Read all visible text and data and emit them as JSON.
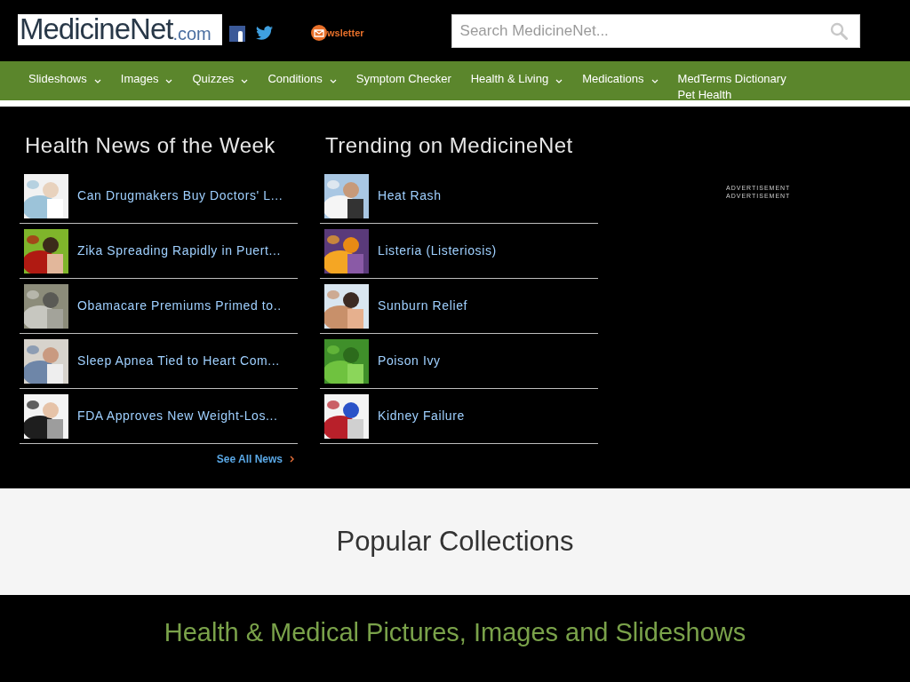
{
  "header": {
    "logo": {
      "main": "MedicineNet",
      "suffix": ".com"
    },
    "newsletter": "wsletter",
    "search": {
      "placeholder": "Search MedicineNet..."
    }
  },
  "nav": [
    {
      "label": "Slideshows",
      "dropdown": true
    },
    {
      "label": "Images",
      "dropdown": true
    },
    {
      "label": "Quizzes",
      "dropdown": true
    },
    {
      "label": "Conditions",
      "dropdown": true
    },
    {
      "label": "Symptom Checker",
      "dropdown": false
    },
    {
      "label": "Health & Living",
      "dropdown": true
    },
    {
      "label": "Medications",
      "dropdown": true
    },
    {
      "label": "MedTerms Dictionary",
      "dropdown": false
    },
    {
      "label": "Pet Health",
      "dropdown": false
    }
  ],
  "news": {
    "title": "Health News of the Week",
    "items": [
      {
        "title": "Can Drugmakers Buy Doctors' L..."
      },
      {
        "title": "Zika Spreading Rapidly in Puert..."
      },
      {
        "title": "Obamacare Premiums Primed to.."
      },
      {
        "title": "Sleep Apnea Tied to Heart Com..."
      },
      {
        "title": "FDA Approves New Weight-Los..."
      }
    ],
    "see_all": "See All News"
  },
  "trending": {
    "title": "Trending on MedicineNet",
    "items": [
      {
        "title": "Heat Rash"
      },
      {
        "title": "Listeria (Listeriosis)"
      },
      {
        "title": "Sunburn Relief"
      },
      {
        "title": "Poison Ivy"
      },
      {
        "title": "Kidney Failure"
      }
    ]
  },
  "ads": [
    "ADVERTISEMENT",
    "ADVERTISEMENT"
  ],
  "popular": {
    "title": "Popular Collections"
  },
  "gallery": {
    "title": "Health & Medical Pictures, Images and Slideshows"
  }
}
